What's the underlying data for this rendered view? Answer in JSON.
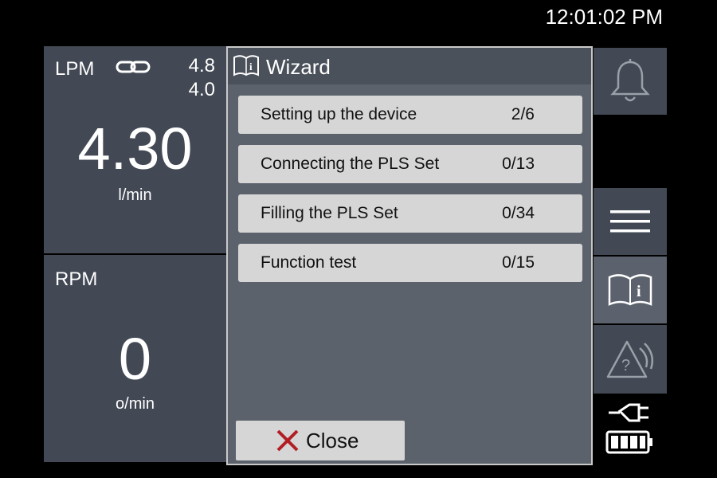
{
  "status": {
    "clock": "12:01:02 PM"
  },
  "lpm": {
    "label": "LPM",
    "limit_high": "4.8",
    "limit_low": "4.0",
    "value": "4.30",
    "unit": "l/min"
  },
  "rpm": {
    "label": "RPM",
    "value": "0",
    "unit": "o/min"
  },
  "sidebar": {
    "icons": [
      "bell-icon",
      "menu-icon",
      "book-info-icon",
      "warning-question-icon",
      "plug-icon",
      "battery-icon"
    ]
  },
  "wizard": {
    "title": "Wizard",
    "steps": [
      {
        "name": "Setting up the device",
        "count": "2/6"
      },
      {
        "name": "Connecting the PLS Set",
        "count": "0/13"
      },
      {
        "name": "Filling the PLS Set",
        "count": "0/34"
      },
      {
        "name": "Function test",
        "count": "0/15"
      }
    ],
    "close_label": "Close"
  },
  "colors": {
    "panel": "#424954",
    "dialog": "#5b626c",
    "step_bg": "#d6d6d6",
    "close_x": "#b11e23"
  }
}
